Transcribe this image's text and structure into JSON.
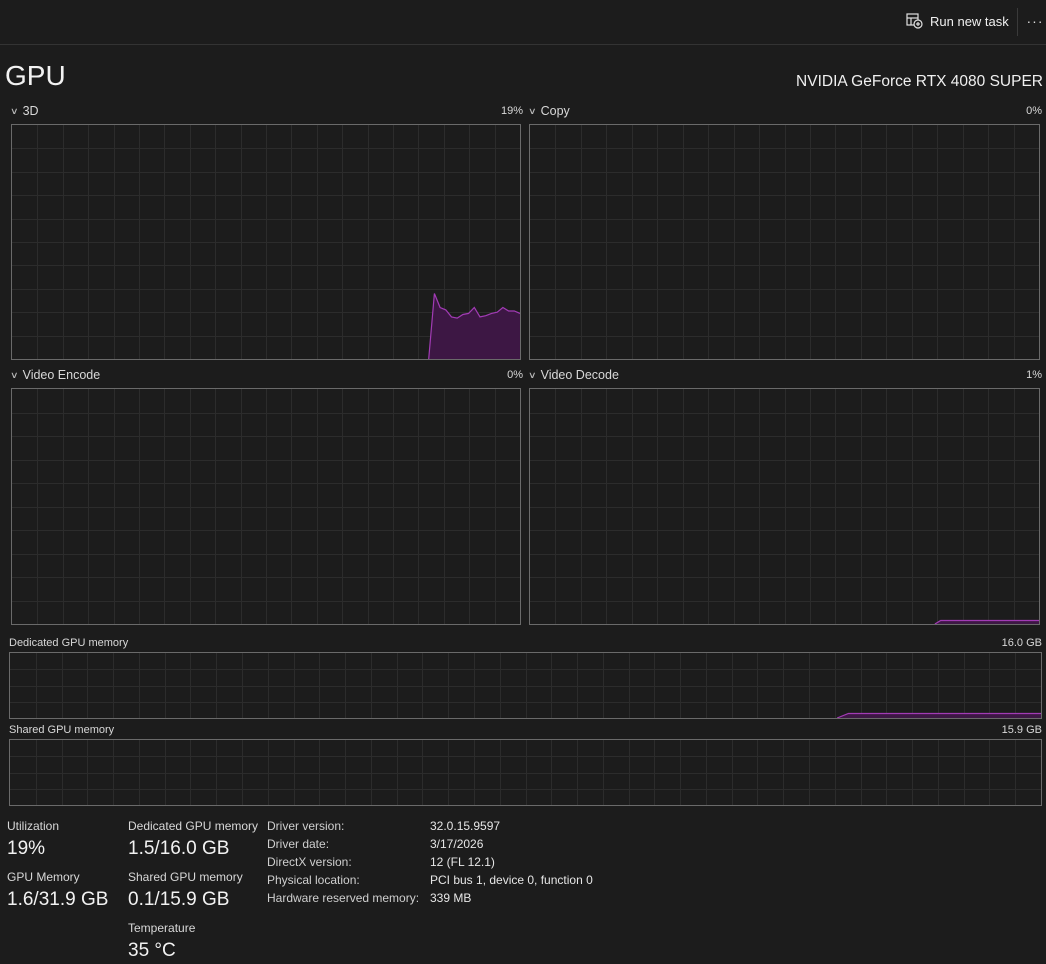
{
  "toolbar": {
    "run_new_task_label": "Run new task",
    "more_label": "···"
  },
  "header": {
    "title": "GPU",
    "device_name": "NVIDIA GeForce RTX 4080 SUPER"
  },
  "engines": [
    {
      "label": "3D",
      "value": "19%",
      "samples": [
        0,
        0,
        0,
        0,
        0,
        0,
        0,
        0,
        0,
        0,
        0,
        0,
        0,
        0,
        0,
        0,
        0,
        0,
        0,
        0,
        0,
        0,
        0,
        0,
        0,
        0,
        0,
        0,
        0,
        0,
        0,
        0,
        0,
        0,
        0,
        0,
        0,
        0,
        0,
        0,
        0,
        0,
        0,
        0,
        0,
        0,
        0,
        0,
        0,
        0,
        0,
        0,
        0,
        0,
        0,
        0,
        0,
        0,
        0,
        0,
        0,
        0,
        0,
        0,
        0,
        0,
        0,
        0,
        0,
        0,
        0,
        0,
        0,
        0,
        28,
        22,
        21,
        18,
        17.5,
        19,
        19.5,
        22,
        18,
        18.5,
        19.5,
        20,
        22,
        20.5,
        20.5,
        19.5
      ]
    },
    {
      "label": "Copy",
      "value": "0%",
      "samples": []
    },
    {
      "label": "Video Encode",
      "value": "0%",
      "samples": []
    },
    {
      "label": "Video Decode",
      "value": "1%",
      "samples": [
        0,
        0,
        0,
        0,
        0,
        0,
        0,
        0,
        0,
        0,
        0,
        0,
        0,
        0,
        0,
        0,
        0,
        0,
        0,
        0,
        0,
        0,
        0,
        0,
        0,
        0,
        0,
        0,
        0,
        0,
        0,
        0,
        0,
        0,
        0,
        0,
        0,
        0,
        0,
        0,
        0,
        0,
        0,
        0,
        0,
        0,
        0,
        0,
        0,
        0,
        0,
        0,
        0,
        0,
        0,
        0,
        0,
        0,
        0,
        0,
        0,
        0,
        0,
        0,
        0,
        0,
        0,
        0,
        0,
        0,
        0,
        1.5,
        1.5,
        1.5,
        1.5,
        1.5,
        1.5,
        1.5,
        1.5,
        1.5,
        1.5,
        1.5,
        1.5,
        1.5,
        1.5,
        1.5,
        1.5,
        1.5,
        1.5
      ]
    }
  ],
  "memory_graphs": [
    {
      "label": "Dedicated GPU memory",
      "value": "16.0 GB",
      "samples": [
        0,
        0,
        0,
        0,
        0,
        0,
        0,
        0,
        0,
        0,
        0,
        0,
        0,
        0,
        0,
        0,
        0,
        0,
        0,
        0,
        0,
        0,
        0,
        0,
        0,
        0,
        0,
        0,
        0,
        0,
        0,
        0,
        0,
        0,
        0,
        0,
        0,
        0,
        0,
        0,
        0,
        0,
        0,
        0,
        0,
        0,
        0,
        0,
        0,
        0,
        0,
        0,
        0,
        0,
        0,
        0,
        0,
        0,
        0,
        0,
        0,
        0,
        0,
        0,
        0,
        0,
        0,
        0,
        0,
        0,
        0,
        0,
        0,
        0,
        7,
        7,
        7,
        7,
        7,
        7,
        7,
        7,
        7,
        7,
        7,
        7,
        7,
        7,
        7,
        7,
        7,
        7
      ]
    },
    {
      "label": "Shared GPU memory",
      "value": "15.9 GB",
      "samples": []
    }
  ],
  "stats": {
    "utilization_label": "Utilization",
    "utilization_value": "19%",
    "gpu_memory_label": "GPU Memory",
    "gpu_memory_value": "1.6/31.9 GB",
    "dedicated_label": "Dedicated GPU memory",
    "dedicated_value": "1.5/16.0 GB",
    "shared_label": "Shared GPU memory",
    "shared_value": "0.1/15.9 GB",
    "temperature_label": "Temperature",
    "temperature_value": "35 °C"
  },
  "properties": [
    {
      "key": "Driver version:",
      "value": "32.0.15.9597"
    },
    {
      "key": "Driver date:",
      "value": "3/17/2026"
    },
    {
      "key": "DirectX version:",
      "value": "12 (FL 12.1)"
    },
    {
      "key": "Physical location:",
      "value": "PCI bus 1, device 0, function 0"
    },
    {
      "key": "Hardware reserved memory:",
      "value": "339 MB"
    }
  ],
  "colors": {
    "accent": "#a23bb5",
    "fill": "#3d1744",
    "grid": "#2c2c2c",
    "border": "#6a6a6a"
  }
}
